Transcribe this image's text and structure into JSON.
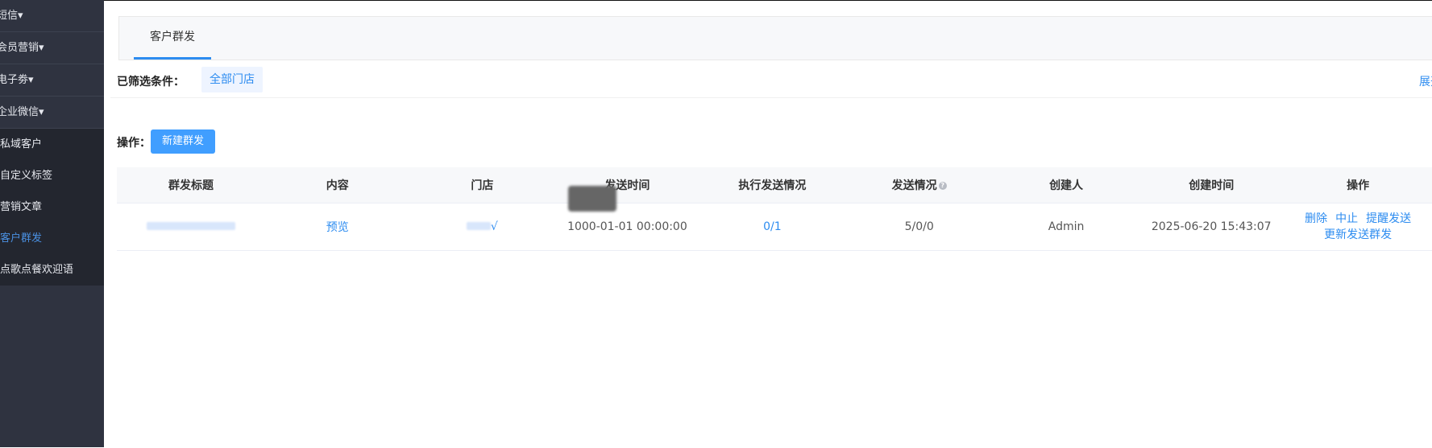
{
  "sidebar": {
    "groups": [
      {
        "label": "短信▾"
      },
      {
        "label": "会员营销▾"
      },
      {
        "label": "电子劵▾"
      },
      {
        "label": "企业微信▾"
      }
    ],
    "subitems": [
      {
        "label": "私域客户"
      },
      {
        "label": "自定义标签"
      },
      {
        "label": "营销文章"
      },
      {
        "label": "客户群发",
        "active": true
      },
      {
        "label": "点歌点餐欢迎语"
      }
    ]
  },
  "tabs": [
    {
      "label": "客户群发"
    }
  ],
  "filter": {
    "label": "已筛选条件：",
    "tag": "全部门店",
    "expand": "展开"
  },
  "operations": {
    "label": "操作：",
    "new_button": "新建群发"
  },
  "table": {
    "headers": [
      "群发标题",
      "内容",
      "门店",
      "发送时间",
      "执行发送情况",
      "发送情况",
      "创建人",
      "创建时间",
      "操作"
    ],
    "rows": [
      {
        "content": "预览",
        "store_suffix": "√",
        "send_time": "1000-01-01 00:00:00",
        "exec": "0/1",
        "status": "5/0/0",
        "creator": "Admin",
        "created": "2025-06-20 15:43:07",
        "actions": [
          "删除",
          "中止",
          "提醒发送",
          "更新发送群发"
        ]
      }
    ]
  },
  "colors": {
    "sidebar": "#2f3340",
    "accent": "#2d8cf0",
    "button": "#409eff"
  }
}
